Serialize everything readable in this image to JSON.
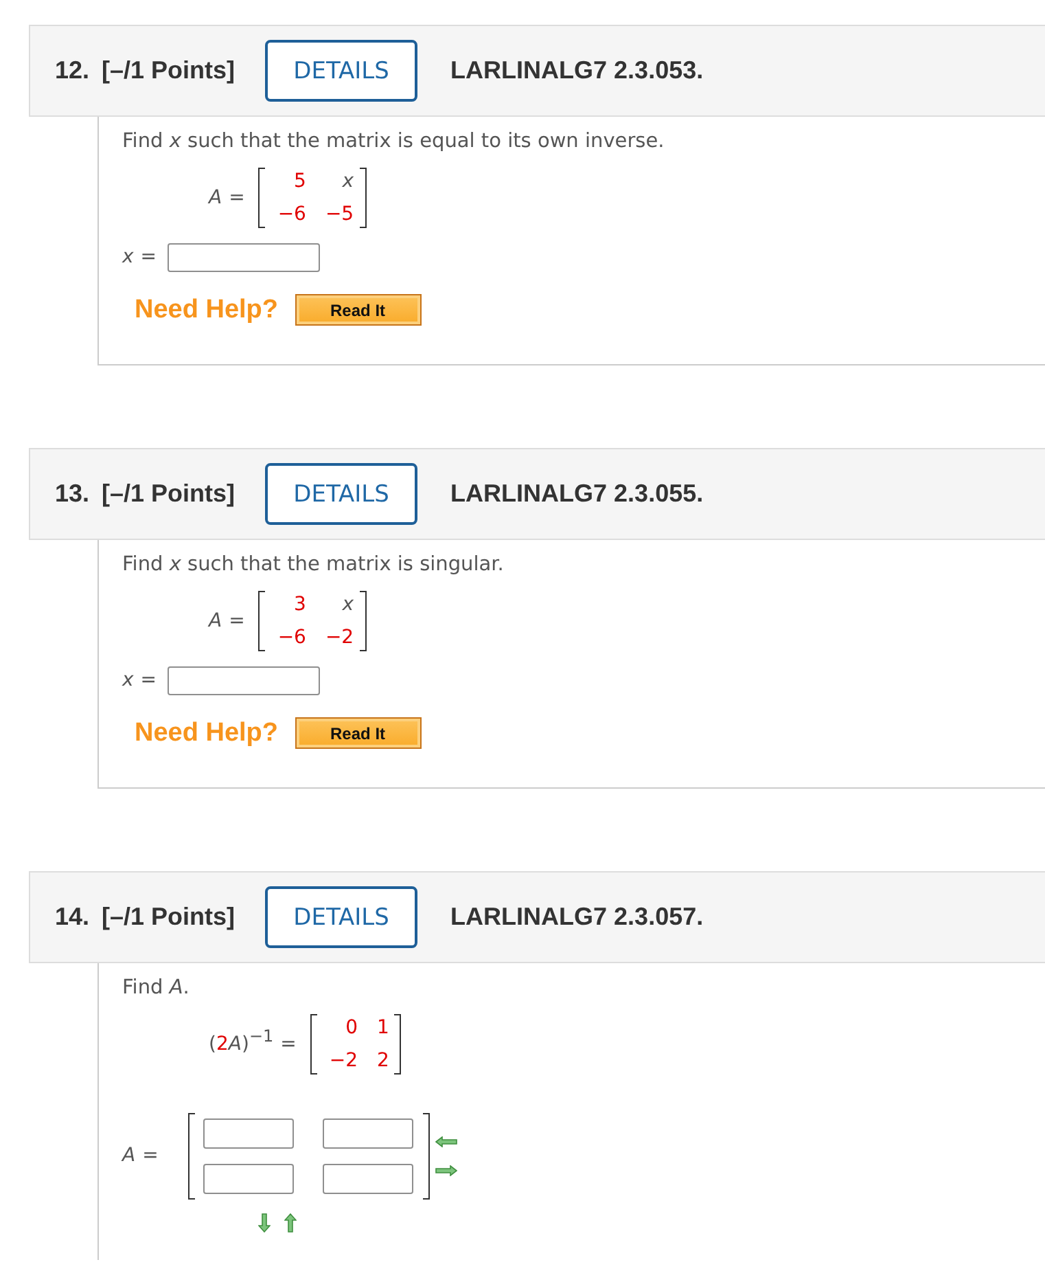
{
  "questions": [
    {
      "number": "12.",
      "points": "[–/1 Points]",
      "details": "DETAILS",
      "reference": "LARLINALG7 2.3.053.",
      "prompt": "Find *x* such that the matrix is equal to its own inverse.",
      "given": {
        "lhs": [
          {
            "text": "A",
            "kind": "variable"
          },
          {
            "text": "=",
            "kind": "symbol"
          }
        ],
        "rows": [
          [
            {
              "text": "5",
              "kind": "number"
            },
            {
              "text": "x",
              "kind": "variable"
            }
          ],
          [
            {
              "text": "−6",
              "kind": "number"
            },
            {
              "text": "−5",
              "kind": "number"
            }
          ]
        ]
      },
      "answer": {
        "kind": "scalar",
        "lhs": [
          {
            "text": "x",
            "kind": "variable"
          },
          {
            "text": "=",
            "kind": "symbol"
          }
        ]
      },
      "help": {
        "label": "Need Help?",
        "button": "Read It"
      }
    },
    {
      "number": "13.",
      "points": "[–/1 Points]",
      "details": "DETAILS",
      "reference": "LARLINALG7 2.3.055.",
      "prompt": "Find *x* such that the matrix is singular.",
      "given": {
        "lhs": [
          {
            "text": "A",
            "kind": "variable"
          },
          {
            "text": "=",
            "kind": "symbol"
          }
        ],
        "rows": [
          [
            {
              "text": "3",
              "kind": "number"
            },
            {
              "text": "x",
              "kind": "variable"
            }
          ],
          [
            {
              "text": "−6",
              "kind": "number"
            },
            {
              "text": "−2",
              "kind": "number"
            }
          ]
        ]
      },
      "answer": {
        "kind": "scalar",
        "lhs": [
          {
            "text": "x",
            "kind": "variable"
          },
          {
            "text": "=",
            "kind": "symbol"
          }
        ]
      },
      "help": {
        "label": "Need Help?",
        "button": "Read It"
      }
    },
    {
      "number": "14.",
      "points": "[–/1 Points]",
      "details": "DETAILS",
      "reference": "LARLINALG7 2.3.057.",
      "prompt": "Find *A*.",
      "given": {
        "lhs": [
          {
            "text": "(",
            "kind": "symbol"
          },
          {
            "text": "2",
            "kind": "number"
          },
          {
            "text": "A",
            "kind": "variable"
          },
          {
            "text": ")",
            "kind": "symbol"
          },
          {
            "text": "−1",
            "kind": "superscript"
          },
          {
            "text": "=",
            "kind": "symbol"
          }
        ],
        "rows": [
          [
            {
              "text": "0",
              "kind": "number"
            },
            {
              "text": "1",
              "kind": "number"
            }
          ],
          [
            {
              "text": "−2",
              "kind": "number"
            },
            {
              "text": "2",
              "kind": "number"
            }
          ]
        ]
      },
      "answer": {
        "kind": "matrix",
        "lhs": [
          {
            "text": "A",
            "kind": "variable"
          },
          {
            "text": "=",
            "kind": "symbol"
          }
        ],
        "rows": [
          [
            {
              "kind": "input"
            },
            {
              "kind": "input"
            }
          ],
          [
            {
              "kind": "input"
            },
            {
              "kind": "input"
            }
          ]
        ],
        "resize_arrows": true
      }
    }
  ]
}
